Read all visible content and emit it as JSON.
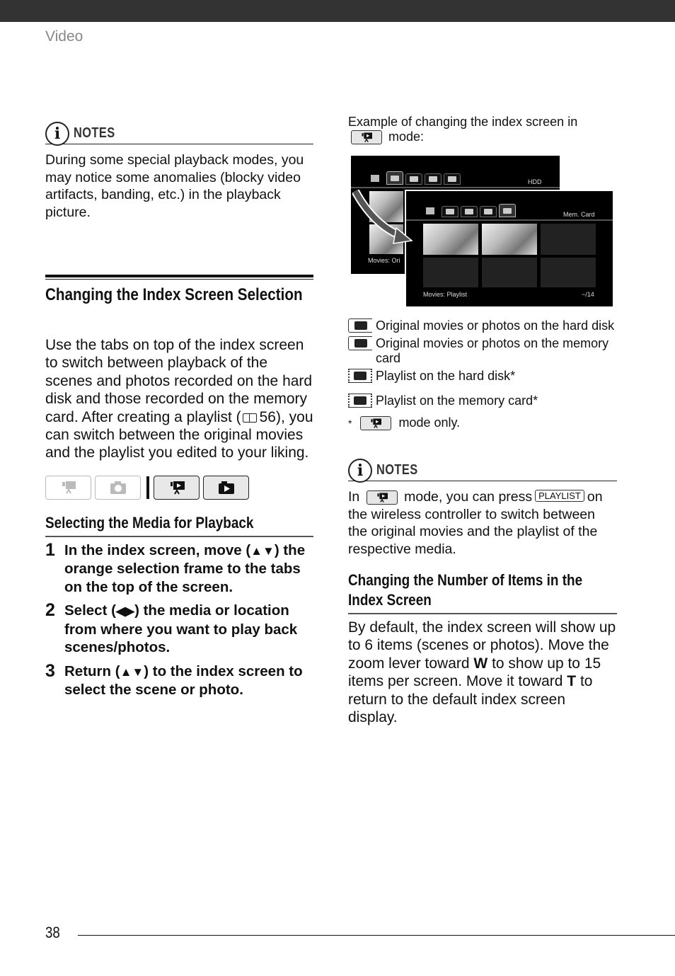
{
  "header": {
    "section": "Video"
  },
  "left": {
    "notes": {
      "title": "NOTES",
      "icon": "info-icon",
      "text": "During some special playback modes, you may notice some anomalies (blocky video artifacts, banding, etc.) in the playback picture."
    },
    "heading": "Changing the Index Screen Selection",
    "intro": {
      "before_ref": "Use the tabs on top of the index screen to switch between playback of the scenes and photos recorded on the hard disk and those recorded on the memory card. After creating a playlist (",
      "ref_icon": "book-icon",
      "ref_page": "56",
      "after_ref": "), you can switch between the original movies and the playlist you edited to your liking."
    },
    "mode_icons": [
      {
        "name": "movie-record-mode",
        "active": false
      },
      {
        "name": "photo-record-mode",
        "active": false
      },
      {
        "name": "movie-playback-mode",
        "active": true
      },
      {
        "name": "photo-playback-mode",
        "active": true
      }
    ],
    "subheading": "Selecting the Media for Playback",
    "steps": [
      {
        "num": "1",
        "pre": "In the index screen, move (",
        "arrows": "▲▼",
        "post": ") the orange selection frame to the tabs on the top of the screen."
      },
      {
        "num": "2",
        "pre": "Select (",
        "arrows": "◀▶",
        "post": ") the media or location from where you want to play back scenes/photos."
      },
      {
        "num": "3",
        "pre": "Return (",
        "arrows": "▲▼",
        "post": ") to the index screen to select the scene or photo."
      }
    ]
  },
  "right": {
    "example_caption_pre": "Example of changing the index screen in",
    "example_caption_post": "mode:",
    "illustration": {
      "back_screen": {
        "media_label": "HDD",
        "footer_label": "Movies: Ori"
      },
      "front_screen": {
        "media_label": "Mem. Card",
        "footer_label": "Movies: Playlist",
        "counter": "−/14"
      }
    },
    "legend": [
      {
        "icon": "hdd-original-icon",
        "playlist": false,
        "text": "Original movies or photos on the hard disk"
      },
      {
        "icon": "sd-original-icon",
        "playlist": false,
        "text": "Original movies or photos on the memory card"
      },
      {
        "icon": "hdd-playlist-icon",
        "playlist": true,
        "text": "Playlist on the hard disk*"
      },
      {
        "icon": "sd-playlist-icon",
        "playlist": true,
        "text": "Playlist on the memory card*"
      }
    ],
    "legend_footnote": {
      "star": "*",
      "text": "mode only."
    },
    "notes": {
      "title": "NOTES",
      "in": "In",
      "mid": "mode, you can press",
      "key": "PLAYLIST",
      "post": "on the wireless controller to switch between the original movies and the playlist of the respective media."
    },
    "subheading": "Changing the Number of Items in the Index Screen",
    "body": {
      "p1": "By default, the index screen will show up to 6 items (scenes or photos). Move the zoom lever toward ",
      "w": "W",
      "p2": " to show up to 15 items per screen. Move it toward ",
      "t": "T",
      "p3": " to return to the default index screen display."
    }
  },
  "footer": {
    "page_number": "38"
  }
}
